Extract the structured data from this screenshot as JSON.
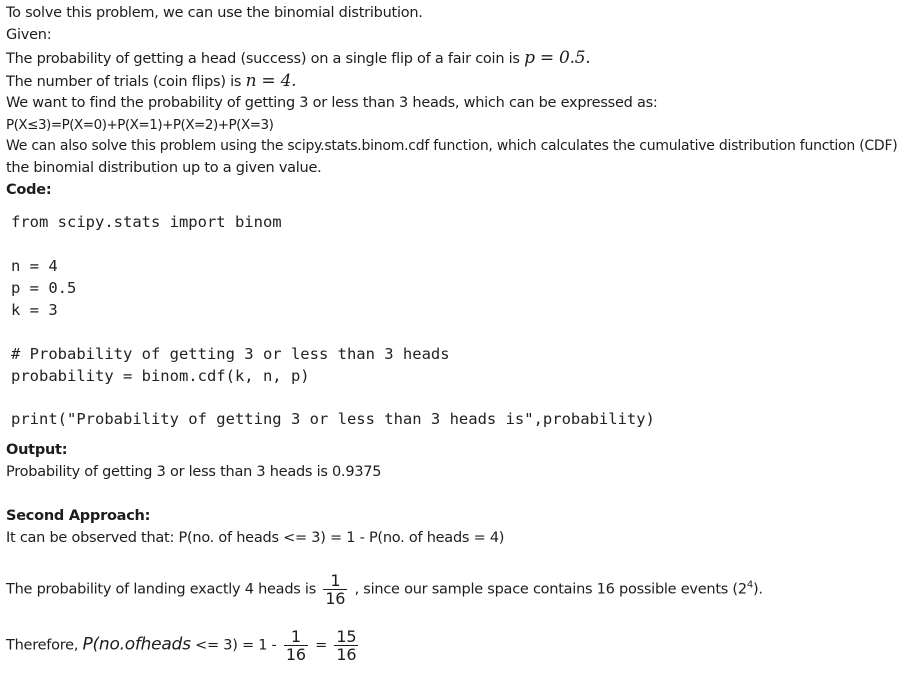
{
  "text": {
    "intro": "To solve this problem, we can use the binomial distribution.",
    "given": "Given:",
    "p_line_pre": "The probability of getting a head (success) on a single flip of a fair coin is",
    "p_math": "p = 0.5.",
    "n_line_pre": "The number of trials (coin flips) is",
    "n_math": "n = 4.",
    "want": "We want to find the probability of getting 3 or less than 3 heads, which can be expressed as:",
    "formula": "P(X≤3)=P(X=0)+P(X=1)+P(X=2)+P(X=3)",
    "scipy_1": "We can also solve this problem using the scipy.stats.binom.cdf function, which calculates the cumulative distribution function (CDF) of",
    "scipy_2": "the binomial distribution up to a given value.",
    "code_heading": "Code:",
    "output_heading": "Output:",
    "output_value": "Probability of getting 3 or less than 3 heads is 0.9375",
    "second_heading": "Second Approach:",
    "observe": "It can be observed that: P(no. of heads <= 3) = 1 - P(no. of heads = 4)",
    "landing_pre": "The probability of landing exactly 4 heads is",
    "frac_one_num": "1",
    "frac_one_den": "16",
    "landing_post": ", since our sample space contains 16 possible events (2",
    "landing_exp": "4",
    "landing_end": ").",
    "therefore": "Therefore,",
    "therefore_math": "P(no.ofheads",
    "therefore_le": "<= 3) = 1 -",
    "frac_two_num": "1",
    "frac_two_den": "16",
    "equals": "=",
    "frac_three_num": "15",
    "frac_three_den": "16"
  },
  "code": {
    "line1": "from scipy.stats import binom",
    "line2": "n = 4",
    "line3": "p = 0.5",
    "line4": "k = 3",
    "line5": "# Probability of getting 3 or less than 3 heads",
    "line6": "probability = binom.cdf(k, n, p)",
    "line7": "print(\"Probability of getting 3 or less than 3 heads is\",probability)"
  }
}
